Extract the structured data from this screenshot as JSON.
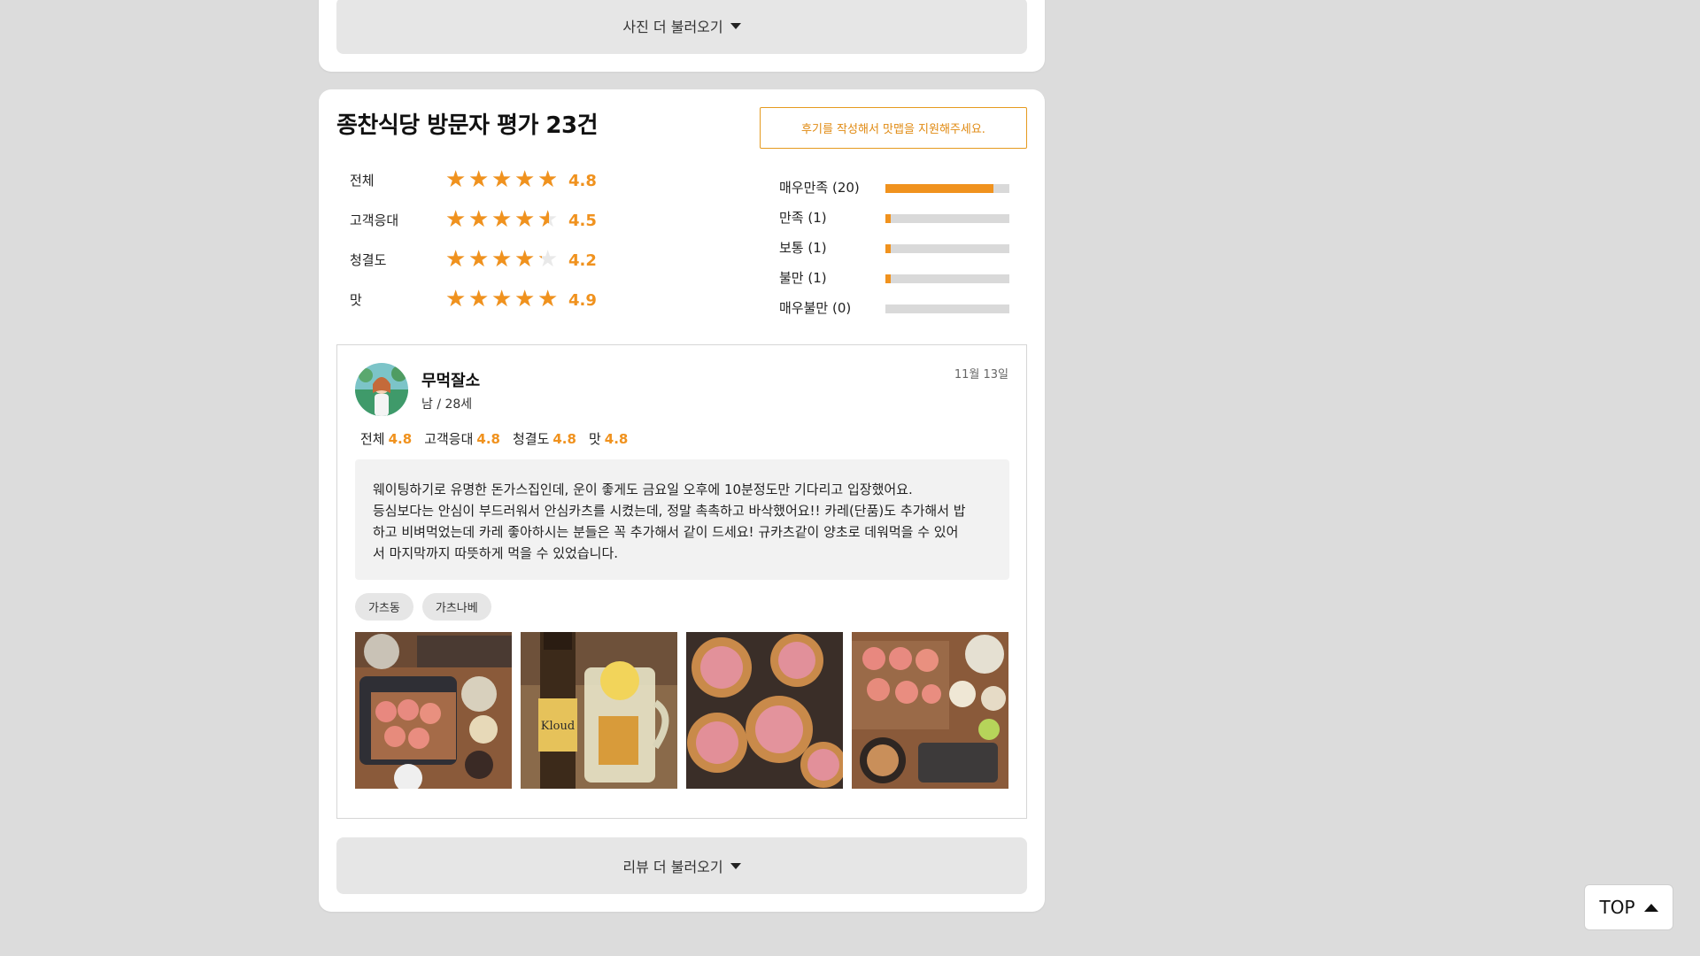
{
  "photos_section": {
    "more_label": "사진 더 불러오기"
  },
  "reviews": {
    "title": "종찬식당 방문자 평가 23건",
    "write_prompt": "후기를 작성해서 맛맵을 지원해주세요.",
    "accent_color": "#f0921e",
    "scores": [
      {
        "label": "전체",
        "value": "4.8",
        "rating": 4.8
      },
      {
        "label": "고객응대",
        "value": "4.5",
        "rating": 4.5
      },
      {
        "label": "청결도",
        "value": "4.2",
        "rating": 4.2
      },
      {
        "label": "맛",
        "value": "4.9",
        "rating": 4.9
      }
    ],
    "distribution": [
      {
        "label": "매우만족 (20)",
        "fraction": 0.87
      },
      {
        "label": "만족 (1)",
        "fraction": 0.04
      },
      {
        "label": "보통 (1)",
        "fraction": 0.04
      },
      {
        "label": "불만 (1)",
        "fraction": 0.04
      },
      {
        "label": "매우불만 (0)",
        "fraction": 0
      }
    ],
    "item": {
      "nickname": "무먹잘소",
      "meta": "남 / 28세",
      "date": "11월 13일",
      "mini_scores": [
        {
          "label": "전체",
          "value": "4.8"
        },
        {
          "label": "고객응대",
          "value": "4.8"
        },
        {
          "label": "청결도",
          "value": "4.8"
        },
        {
          "label": "맛",
          "value": "4.8"
        }
      ],
      "text_lines": [
        "웨이팅하기로 유명한 돈가스집인데, 운이 좋게도 금요일 오후에 10분정도만 기다리고 입장했어요.",
        "등심보다는 안심이 부드러워서 안심카츠를 시켰는데, 정말 촉촉하고 바삭했어요!! 카레(단품)도 추가해서 밥",
        "하고 비벼먹었는데 카레 좋아하시는 분들은 꼭 추가해서 같이 드세요! 규카츠같이 양초로 데워먹을 수 있어",
        "서 마지막까지 따뜻하게 먹을 수 있었습니다."
      ],
      "tags": [
        "가츠동",
        "가츠나베"
      ],
      "photo_labels": [
        "Kloud"
      ]
    },
    "more_label": "리뷰 더 불러오기"
  },
  "scroll_top_label": "TOP"
}
